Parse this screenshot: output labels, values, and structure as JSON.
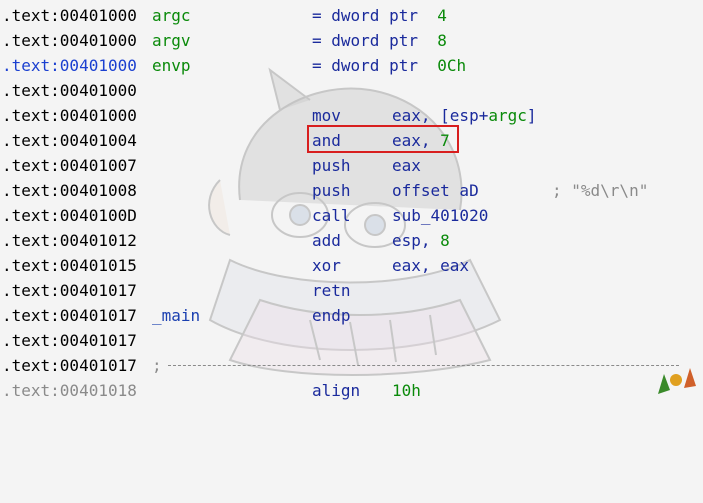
{
  "rows": [
    {
      "addr": ".text:00401000",
      "label": "argc",
      "mnemonic": "= dword ptr",
      "imm": "4"
    },
    {
      "addr": ".text:00401000",
      "label": "argv",
      "mnemonic": "= dword ptr",
      "imm": "8"
    },
    {
      "addr": ".text:00401000",
      "label": "envp",
      "mnemonic": "= dword ptr",
      "imm": "0Ch"
    },
    {
      "addr": ".text:00401000"
    },
    {
      "addr": ".text:00401000",
      "mnemonic": "mov",
      "operands_pre": "eax, [esp+",
      "operands_var": "argc",
      "operands_post": "]"
    },
    {
      "addr": ".text:00401004",
      "mnemonic": "and",
      "operands_pre": "eax, ",
      "operands_imm": "7"
    },
    {
      "addr": ".text:00401007",
      "mnemonic": "push",
      "operands": "eax"
    },
    {
      "addr": ".text:00401008",
      "mnemonic": "push",
      "operands": "offset aD",
      "comment": "; \"%d\\r\\n\""
    },
    {
      "addr": ".text:0040100D",
      "mnemonic": "call",
      "operands": "sub_401020"
    },
    {
      "addr": ".text:00401012",
      "mnemonic": "add",
      "operands_pre": "esp, ",
      "operands_imm": "8"
    },
    {
      "addr": ".text:00401015",
      "mnemonic": "xor",
      "operands": "eax, eax"
    },
    {
      "addr": ".text:00401017",
      "mnemonic": "retn"
    },
    {
      "addr": ".text:00401017",
      "label": "_main",
      "mnemonic": "endp"
    },
    {
      "addr": ".text:00401017"
    },
    {
      "addr": ".text:00401017",
      "separator": ";"
    },
    {
      "addr": ".text:00401018",
      "mnemonic": "align",
      "operands_imm": "10h"
    }
  ],
  "colors": {
    "address": "#000000",
    "address_faded": "#8a8a8a",
    "address_highlighted": "#1a3fd0",
    "label": "#0a8a0a",
    "mnemonic": "#1a2a9c",
    "immediate": "#0a8a0a",
    "comment": "#8a8a8a",
    "highlight_box": "#d81e1e",
    "background": "#f4f4f4"
  }
}
